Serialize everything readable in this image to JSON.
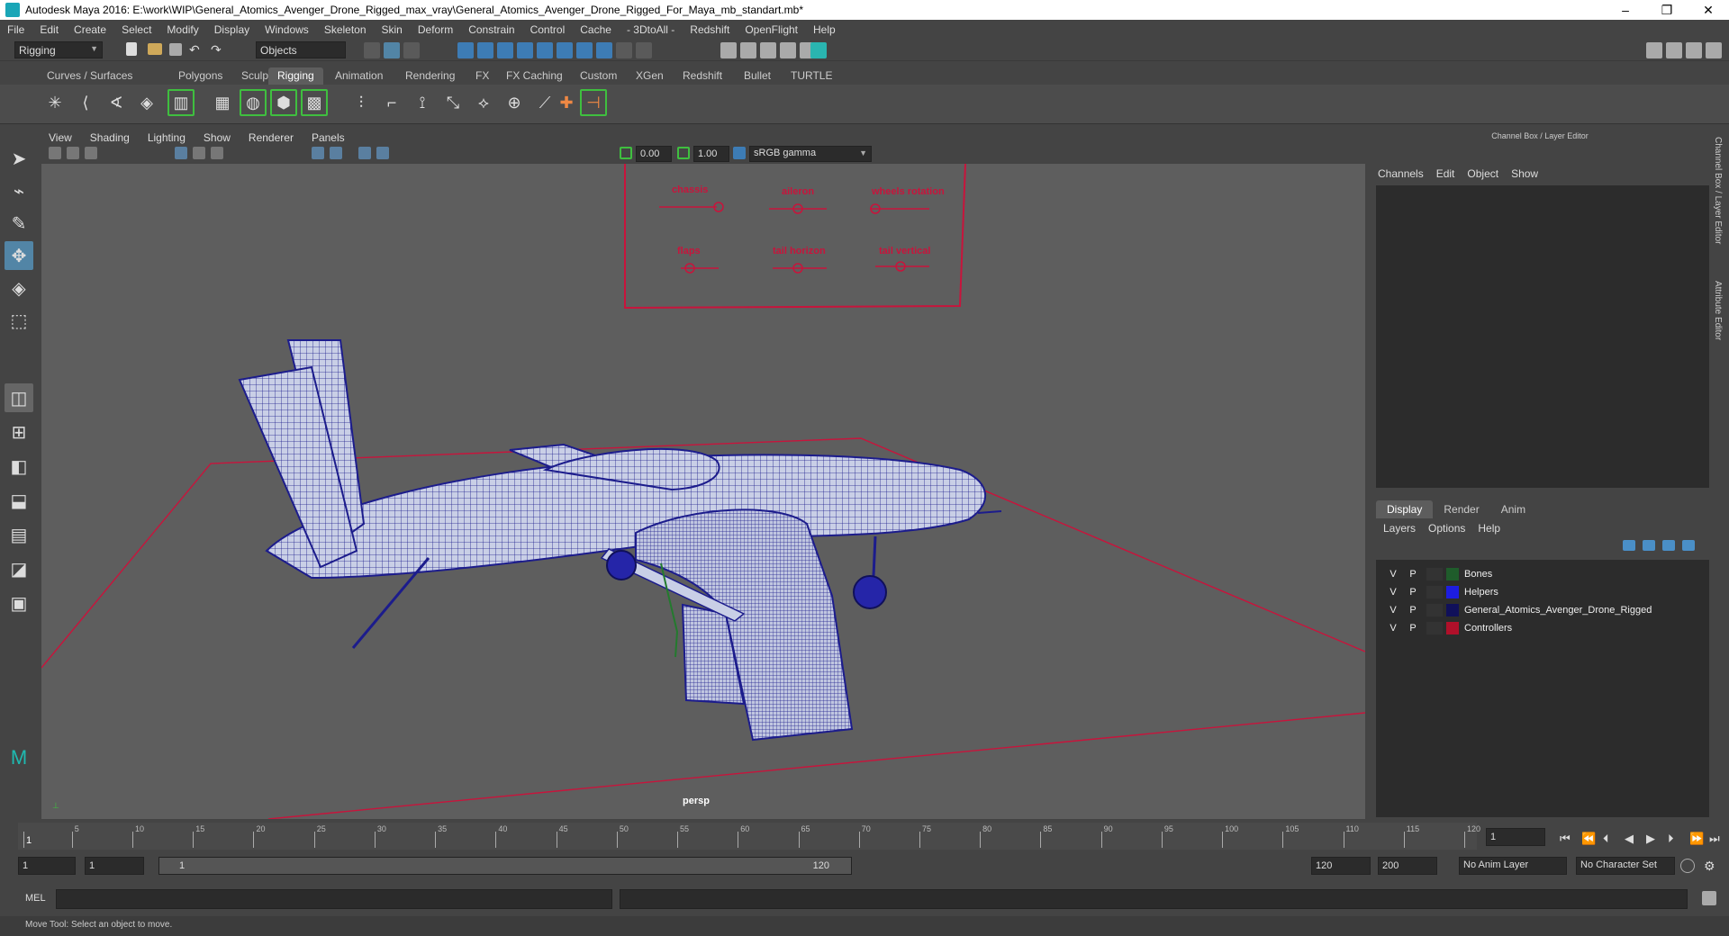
{
  "window": {
    "title": "Autodesk Maya 2016: E:\\work\\WIP\\General_Atomics_Avenger_Drone_Rigged_max_vray\\General_Atomics_Avenger_Drone_Rigged_For_Maya_mb_standart.mb*",
    "minimize": "–",
    "maximize": "❐",
    "close": "✕"
  },
  "menubar": [
    "File",
    "Edit",
    "Create",
    "Select",
    "Modify",
    "Display",
    "Windows",
    "Skeleton",
    "Skin",
    "Deform",
    "Constrain",
    "Control",
    "Cache",
    "- 3DtoAll -",
    "Redshift",
    "OpenFlight",
    "Help"
  ],
  "status": {
    "mode": "Rigging",
    "select_mode": "Objects"
  },
  "shelf_tabs": [
    "Curves / Surfaces",
    "Polygons",
    "Sculpting",
    "Rigging",
    "Animation",
    "Rendering",
    "FX",
    "FX Caching",
    "Custom",
    "XGen",
    "Redshift",
    "Bullet",
    "TURTLE"
  ],
  "active_shelf_tab": "Rigging",
  "panel_menu": [
    "View",
    "Shading",
    "Lighting",
    "Show",
    "Renderer",
    "Panels"
  ],
  "panel_tools": {
    "exposure": "0.00",
    "gamma": "1.00",
    "colorspace": "sRGB gamma"
  },
  "viewport": {
    "camera": "persp",
    "controls": {
      "row1": [
        "chassis",
        "aileron",
        "wheels rotation"
      ],
      "row2": [
        "flaps",
        "tail horizon",
        "tail vertical"
      ]
    }
  },
  "channel_box": {
    "title": "Channel Box / Layer Editor",
    "menu": [
      "Channels",
      "Edit",
      "Object",
      "Show"
    ]
  },
  "layer_editor": {
    "tabs": [
      "Display",
      "Render",
      "Anim"
    ],
    "active_tab": "Display",
    "menu": [
      "Layers",
      "Options",
      "Help"
    ],
    "layers": [
      {
        "v": "V",
        "p": "P",
        "name": "Bones",
        "color": "#1f5c2b"
      },
      {
        "v": "V",
        "p": "P",
        "name": "Helpers",
        "color": "#1d1de0"
      },
      {
        "v": "V",
        "p": "P",
        "name": "General_Atomics_Avenger_Drone_Rigged",
        "color": "#10105a"
      },
      {
        "v": "V",
        "p": "P",
        "name": "Controllers",
        "color": "#b0102a"
      }
    ]
  },
  "side_tabs": [
    "Channel Box / Layer Editor",
    "Attribute Editor"
  ],
  "timeline": {
    "ticks": [
      "1",
      "5",
      "10",
      "15",
      "20",
      "25",
      "30",
      "35",
      "40",
      "45",
      "50",
      "55",
      "60",
      "65",
      "70",
      "75",
      "80",
      "85",
      "90",
      "95",
      "100",
      "105",
      "110",
      "115",
      "120"
    ],
    "current_frame": "1"
  },
  "range": {
    "start": "1",
    "playback_start": "1",
    "slider_start": "1",
    "slider_end": "120",
    "playback_end": "120",
    "end": "200",
    "anim_layer": "No Anim Layer",
    "character_set": "No Character Set"
  },
  "command": {
    "lang": "MEL"
  },
  "help_line": "Move Tool: Select an object to move."
}
